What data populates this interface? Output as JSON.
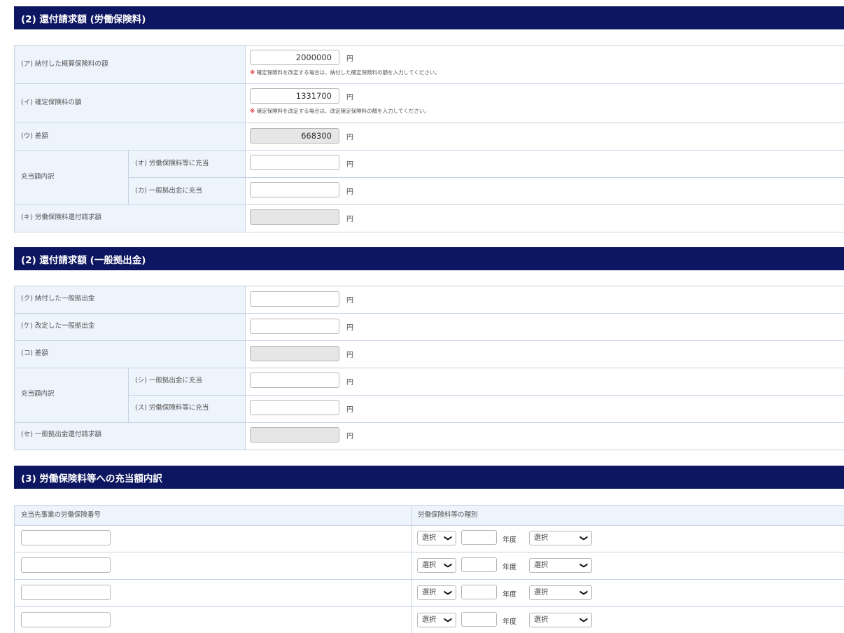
{
  "section1": {
    "title": "(2) 還付請求額 (労働保険料)",
    "rows": {
      "a_label": "(ア) 納付した概算保険料の額",
      "a_value": "2000000",
      "a_note_mark": "※",
      "a_note": "確定保険料を改定する場合は、納付した確定保険料の額を入力してください。",
      "i_label": "(イ) 確定保険料の額",
      "i_value": "1331700",
      "i_note_mark": "※",
      "i_note": "確定保険料を改定する場合は、改定確定保険料の額を入力してください。",
      "u_label": "(ウ) 差額",
      "u_value": "668300",
      "group_label": "充当額内訳",
      "o_label": "(オ) 労働保険料等に充当",
      "o_value": "",
      "ka_label": "(カ) 一般拠出金に充当",
      "ka_value": "",
      "ki_label": "(キ) 労働保険料還付請求額",
      "ki_value": ""
    }
  },
  "section2": {
    "title": "(2) 還付請求額 (一般拠出金)",
    "rows": {
      "ku_label": "(ク) 納付した一般拠出金",
      "ke_label": "(ケ) 改定した一般拠出金",
      "ko_label": "(コ) 差額",
      "group_label": "充当額内訳",
      "shi_label": "(シ) 一般拠出金に充当",
      "su_label": "(ス) 労働保険料等に充当",
      "se_label": "(セ) 一般拠出金還付請求額"
    }
  },
  "section3": {
    "title": "(3) 労働保険料等への充当額内訳",
    "col1_header": "充当先事業の労働保険番号",
    "col2_header": "労働保険料等の種別",
    "select_label": "選択",
    "year_label": "年度"
  },
  "unit": "円",
  "colors": {
    "header_bg": "#0d1660",
    "label_bg": "#eef4fc",
    "note_mark": "#dd3333"
  }
}
